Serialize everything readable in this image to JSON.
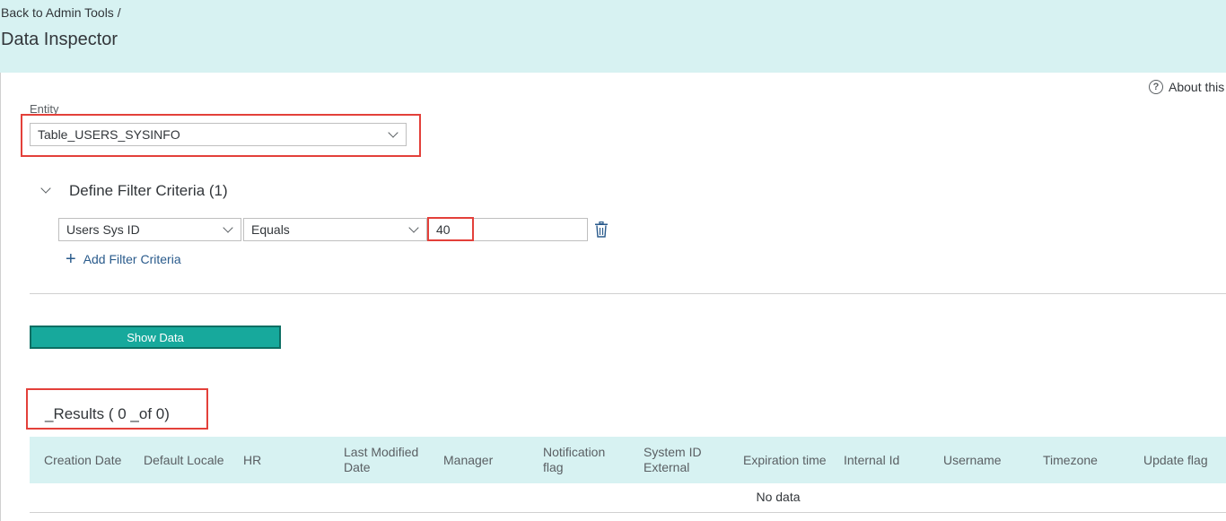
{
  "header": {
    "breadcrumb": "Back to Admin Tools /",
    "title": "Data Inspector"
  },
  "about": {
    "label": "About this",
    "icon": "help-icon"
  },
  "entity": {
    "label": "Entity",
    "selected": "Table_USERS_SYSINFO"
  },
  "filter": {
    "title": "Define Filter Criteria (1)",
    "field": "Users Sys ID",
    "operator": "Equals",
    "value": "40",
    "add_label": "Add Filter Criteria"
  },
  "show_button": "Show Data",
  "results": {
    "title": "_Results ( 0 _of 0)",
    "columns": [
      "Creation Date",
      "Default Locale",
      "HR",
      "Last Modified Date",
      "Manager",
      "Notification flag",
      "System ID External",
      "Expiration time",
      "Internal Id",
      "Username",
      "Timezone",
      "Update flag"
    ],
    "empty_text": "No data"
  },
  "colors": {
    "header_bg": "#d7f2f2",
    "accent": "#17a99c",
    "highlight": "#e3403a"
  }
}
